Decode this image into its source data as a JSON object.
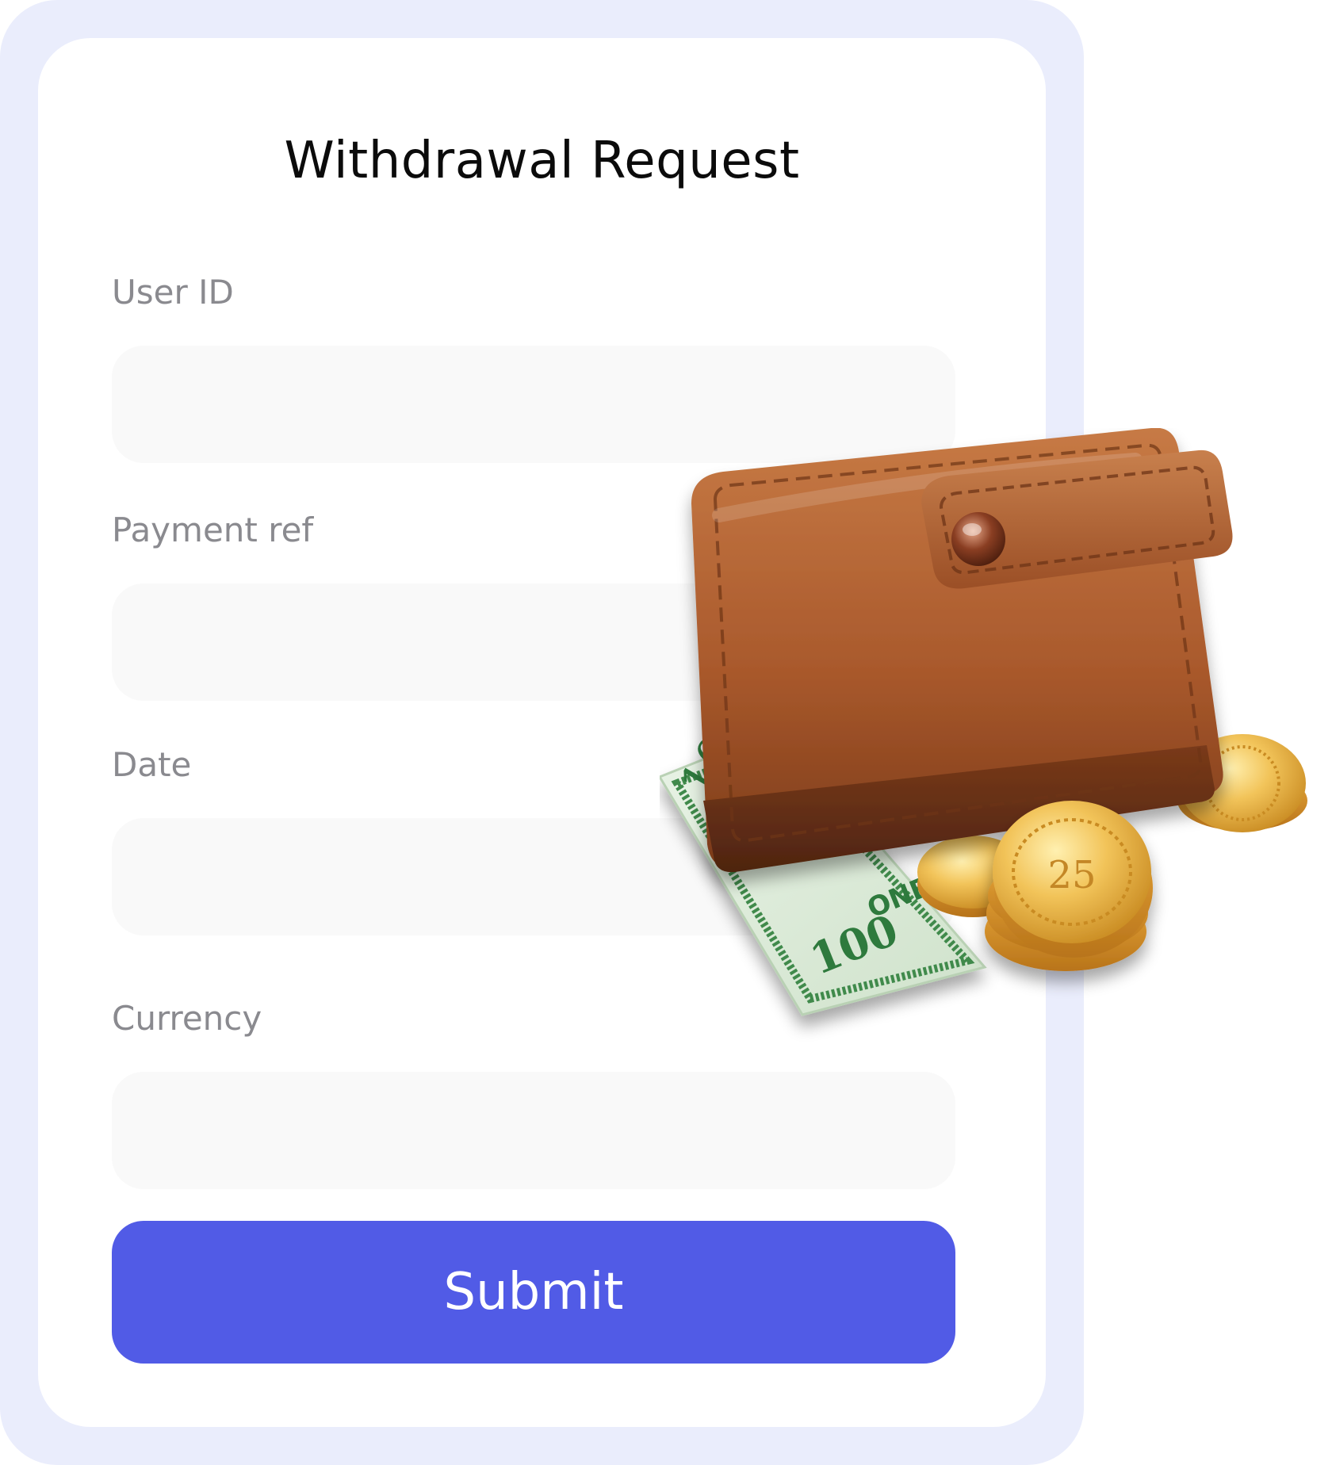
{
  "form": {
    "title": "Withdrawal Request",
    "fields": [
      {
        "label": "User ID",
        "value": "",
        "placeholder": ""
      },
      {
        "label": "Payment ref",
        "value": "",
        "placeholder": ""
      },
      {
        "label": "Date",
        "value": "",
        "placeholder": ""
      },
      {
        "label": "Currency",
        "value": "",
        "placeholder": ""
      }
    ],
    "submit_label": "Submit"
  },
  "illustration": {
    "icon": "wallet-with-cash-and-coins",
    "banknote_text": [
      "100",
      "ONE",
      "100"
    ],
    "coin_text": "25"
  },
  "colors": {
    "frame": "#eaedfc",
    "card": "#ffffff",
    "input_bg": "#f9f9f9",
    "label": "#8a8a8f",
    "button": "#515be6",
    "button_text": "#ffffff",
    "title": "#0b0b0b"
  }
}
